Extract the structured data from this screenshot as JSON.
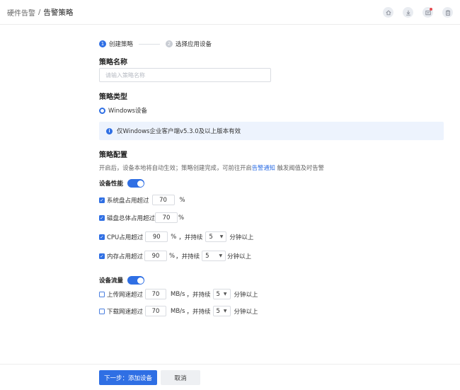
{
  "breadcrumb": {
    "parent": "硬件告警",
    "separator": "/",
    "current": "告警策略"
  },
  "header_icons": [
    "home-icon",
    "download-icon",
    "message-icon",
    "clipboard-icon"
  ],
  "steps": [
    {
      "num": "1",
      "label": "创建策略",
      "active": true
    },
    {
      "num": "2",
      "label": "选择应用设备",
      "active": false
    }
  ],
  "policy_name": {
    "title": "策略名称",
    "placeholder": "请输入策略名称",
    "value": ""
  },
  "policy_type": {
    "title": "策略类型",
    "option": "Windows设备",
    "notice": "仅Windows企业客户端v5.3.0及以上版本有效"
  },
  "policy_config": {
    "title": "策略配置",
    "desc_prefix": "开启后，设备本地将自动生效；策略创建完成，可前往开启",
    "desc_link": "告警通知",
    "desc_suffix": "触发阈值及时告警"
  },
  "performance": {
    "label": "设备性能",
    "enabled": true,
    "items": [
      {
        "label": "系统盘占用超过",
        "value": "70",
        "unit": "%",
        "checked": true
      },
      {
        "label": "磁盘总体占用超过",
        "value": "70",
        "unit": "%",
        "checked": true
      },
      {
        "label": "CPU占用超过",
        "value": "90",
        "unit": "%",
        "sep": "，并持续",
        "duration": "5",
        "duration_unit": "分钟以上",
        "checked": true
      },
      {
        "label": "内存占用超过",
        "value": "90",
        "unit": "%",
        "sep": "，并持续",
        "duration": "5",
        "duration_unit": "分钟以上",
        "checked": true
      }
    ]
  },
  "traffic": {
    "label": "设备流量",
    "enabled": true,
    "items": [
      {
        "label": "上传网速超过",
        "value": "70",
        "unit": "MB/s",
        "sep": "，并持续",
        "duration": "5",
        "duration_unit": "分钟以上",
        "checked": false
      },
      {
        "label": "下载网速超过",
        "value": "70",
        "unit": "MB/s",
        "sep": "，并持续",
        "duration": "5",
        "duration_unit": "分钟以上",
        "checked": false
      }
    ]
  },
  "footer": {
    "next_label": "下一步：添加设备",
    "cancel_label": "取消"
  },
  "colors": {
    "accent": "#2f6fe4",
    "info_bg": "#edf3fd"
  }
}
